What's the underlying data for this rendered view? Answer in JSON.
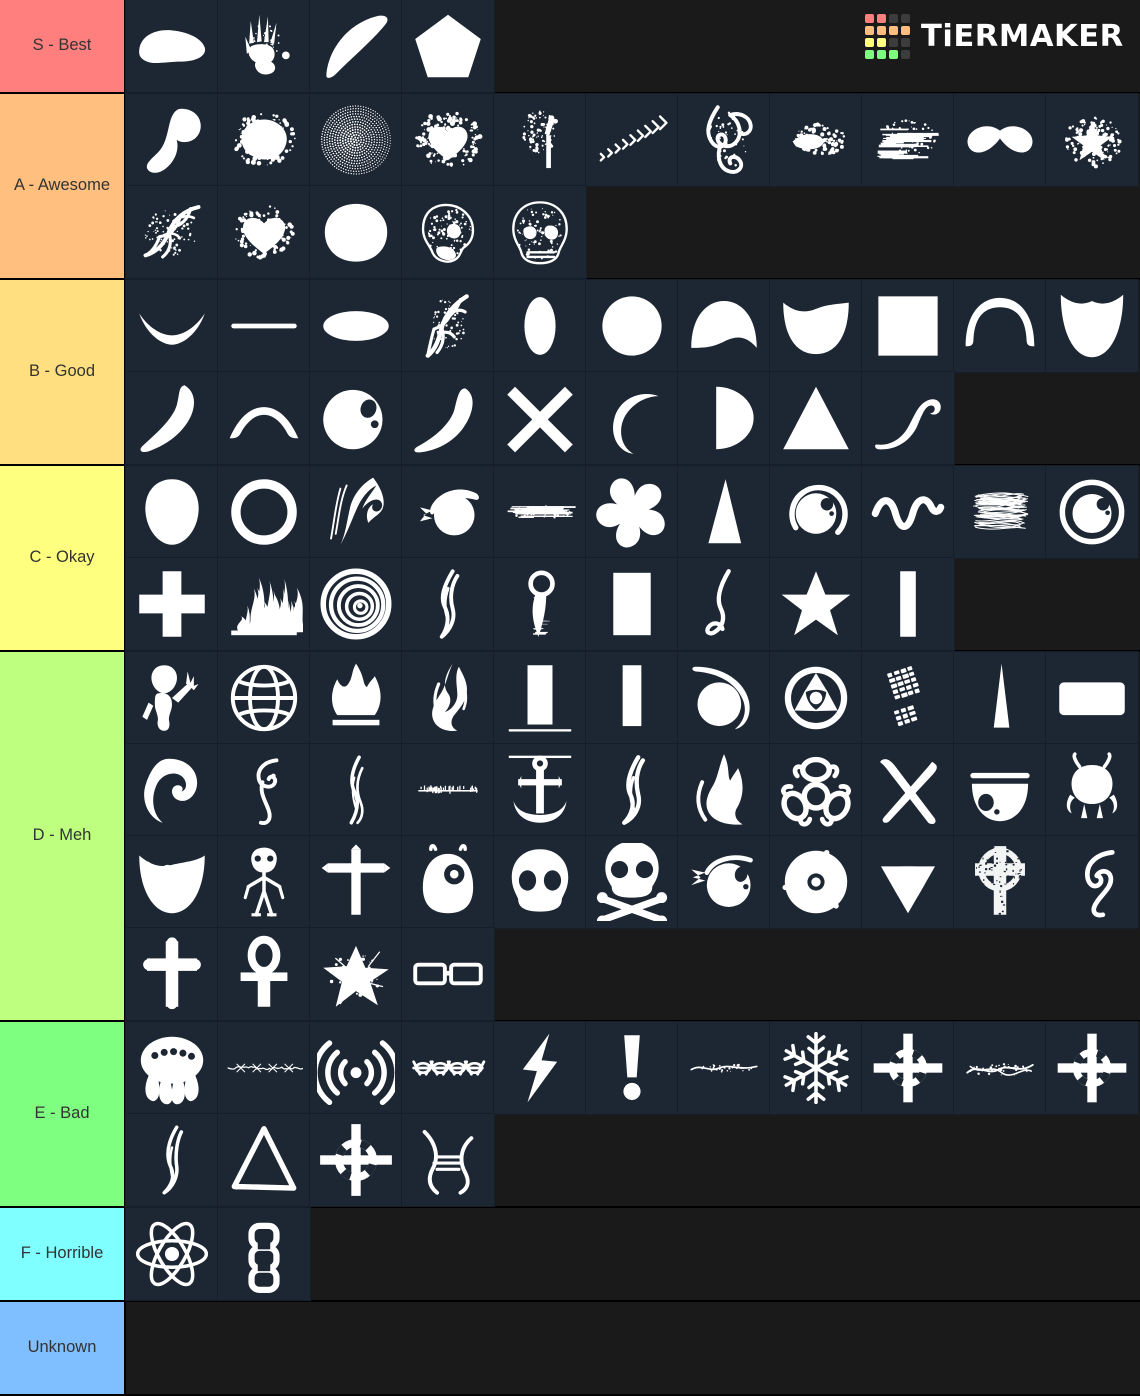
{
  "watermark": {
    "brand": "TiERMAKER",
    "grid_colors": [
      "#ff7f7f",
      "#ff7f7f",
      "#3c3c3c",
      "#3c3c3c",
      "#ffbe7f",
      "#ffbe7f",
      "#ffbe7f",
      "#ffbe7f",
      "#ffff7f",
      "#ffff7f",
      "#3c3c3c",
      "#3c3c3c",
      "#7fff7f",
      "#7fff7f",
      "#7fff7f",
      "#3c3c3c"
    ]
  },
  "colors": {
    "tier_s": "#ff7f7f",
    "tier_a": "#ffbf7f",
    "tier_b": "#ffdf7f",
    "tier_c": "#ffff7f",
    "tier_d": "#bfff7f",
    "tier_e": "#7fff7f",
    "tier_f": "#7fffff",
    "tier_unknown": "#7fbfff",
    "cell_background": "#1d2733",
    "page_background": "#1a1a1a",
    "label_text": "#333333",
    "icon": "#ffffff"
  },
  "tiers": [
    {
      "label": "S - Best",
      "color": "#ff7f7f",
      "items": [
        {
          "name": "blob-smear"
        },
        {
          "name": "handprint"
        },
        {
          "name": "crescent-claw"
        },
        {
          "name": "pentagon"
        }
      ]
    },
    {
      "label": "A - Awesome",
      "color": "#ffbf7f",
      "items": [
        {
          "name": "comma-swirl"
        },
        {
          "name": "paint-splatter"
        },
        {
          "name": "halftone-sphere"
        },
        {
          "name": "splatter-heart"
        },
        {
          "name": "paint-brush-stroke"
        },
        {
          "name": "chevron-trail"
        },
        {
          "name": "ornate-filigree-knot"
        },
        {
          "name": "grunge-spray"
        },
        {
          "name": "scratched-lines"
        },
        {
          "name": "mustache"
        },
        {
          "name": "star-burst-spray"
        },
        {
          "name": "floral-flourish"
        },
        {
          "name": "grunge-heart-outline"
        },
        {
          "name": "paint-ring-blob"
        },
        {
          "name": "skull-side-profile"
        },
        {
          "name": "skull-front-grunge"
        }
      ]
    },
    {
      "label": "B - Good",
      "color": "#ffdf7f",
      "items": [
        {
          "name": "crescent-smile"
        },
        {
          "name": "thin-line"
        },
        {
          "name": "ellipse"
        },
        {
          "name": "filigree-leaf"
        },
        {
          "name": "vertical-oval"
        },
        {
          "name": "circle"
        },
        {
          "name": "wave-cap"
        },
        {
          "name": "cup-shape"
        },
        {
          "name": "square"
        },
        {
          "name": "arch-curve"
        },
        {
          "name": "shield-shape"
        },
        {
          "name": "teardrop-hook"
        },
        {
          "name": "arc-bridge"
        },
        {
          "name": "circle-with-bubbles"
        },
        {
          "name": "comma-tail"
        },
        {
          "name": "x-cross"
        },
        {
          "name": "crescent-moon"
        },
        {
          "name": "half-disc"
        },
        {
          "name": "triangle"
        },
        {
          "name": "s-curve-stroke"
        }
      ]
    },
    {
      "label": "C - Okay",
      "color": "#ffff7f",
      "items": [
        {
          "name": "alien-head"
        },
        {
          "name": "ring-circle"
        },
        {
          "name": "tribal-wave-swirl"
        },
        {
          "name": "comet-ball"
        },
        {
          "name": "scratch-line-grunge"
        },
        {
          "name": "pinwheel-flower"
        },
        {
          "name": "narrow-triangle"
        },
        {
          "name": "eyeball-with-arc"
        },
        {
          "name": "squiggle-wave"
        },
        {
          "name": "brushed-scribble-patch"
        },
        {
          "name": "ringed-eyeball"
        },
        {
          "name": "plus-cross"
        },
        {
          "name": "fire-grunge-bar"
        },
        {
          "name": "spiral-swirl"
        },
        {
          "name": "flame-wisp"
        },
        {
          "name": "feather-flame-drop"
        },
        {
          "name": "rectangle"
        },
        {
          "name": "small-flame-hook"
        },
        {
          "name": "star-five-point"
        },
        {
          "name": "vertical-bar"
        }
      ]
    },
    {
      "label": "D - Meh",
      "color": "#bfff7f",
      "items": [
        {
          "name": "alien-waving"
        },
        {
          "name": "globe-grid"
        },
        {
          "name": "campfire-flame"
        },
        {
          "name": "tribal-flame"
        },
        {
          "name": "tall-rectangle-bar"
        },
        {
          "name": "tall-rectangle-bar-2"
        },
        {
          "name": "comet-swoosh-ball"
        },
        {
          "name": "radiation-circle"
        },
        {
          "name": "boot-print"
        },
        {
          "name": "sharp-spike"
        },
        {
          "name": "rounded-rectangle"
        },
        {
          "name": "spiral-hook-wave"
        },
        {
          "name": "smoke-swirl-wisp"
        },
        {
          "name": "smoke-trail"
        },
        {
          "name": "fine-grunge-strip"
        },
        {
          "name": "anchor"
        },
        {
          "name": "flame-tongue"
        },
        {
          "name": "flame-cluster"
        },
        {
          "name": "biohazard"
        },
        {
          "name": "brush-x-cross"
        },
        {
          "name": "eye-bowl-half"
        },
        {
          "name": "cartoon-alien"
        },
        {
          "name": "toothed-mouth-bowl"
        },
        {
          "name": "alien-standing"
        },
        {
          "name": "cross-gravemarker"
        },
        {
          "name": "alien-hooded-eye"
        },
        {
          "name": "skull"
        },
        {
          "name": "skull-and-crossbones"
        },
        {
          "name": "fish-eye-swoosh"
        },
        {
          "name": "three-blade-disc"
        },
        {
          "name": "radiation-trefoil"
        },
        {
          "name": "celtic-cross"
        },
        {
          "name": "hook-tail-swirl"
        },
        {
          "name": "latin-cross"
        },
        {
          "name": "ankh"
        },
        {
          "name": "grunge-star"
        },
        {
          "name": "sunglasses"
        }
      ]
    },
    {
      "label": "E - Bad",
      "color": "#7fff7f",
      "items": [
        {
          "name": "octopus-alien"
        },
        {
          "name": "barbed-wire-thin"
        },
        {
          "name": "wifi-signal"
        },
        {
          "name": "barbed-wire-bold"
        },
        {
          "name": "lightning-bolt"
        },
        {
          "name": "exclamation-mark"
        },
        {
          "name": "thin-squiggle-wire"
        },
        {
          "name": "snowflake"
        },
        {
          "name": "crosshair-target"
        },
        {
          "name": "twisted-wire"
        },
        {
          "name": "crosshair-target-2"
        },
        {
          "name": "flame-wisp-small"
        },
        {
          "name": "brush-triangle"
        },
        {
          "name": "crosshair-scope"
        },
        {
          "name": "barbed-wire-curl"
        }
      ]
    },
    {
      "label": "F - Horrible",
      "color": "#7fffff",
      "items": [
        {
          "name": "atom"
        },
        {
          "name": "chain-link"
        }
      ]
    },
    {
      "label": "Unknown",
      "color": "#7fbfff",
      "items": []
    }
  ]
}
